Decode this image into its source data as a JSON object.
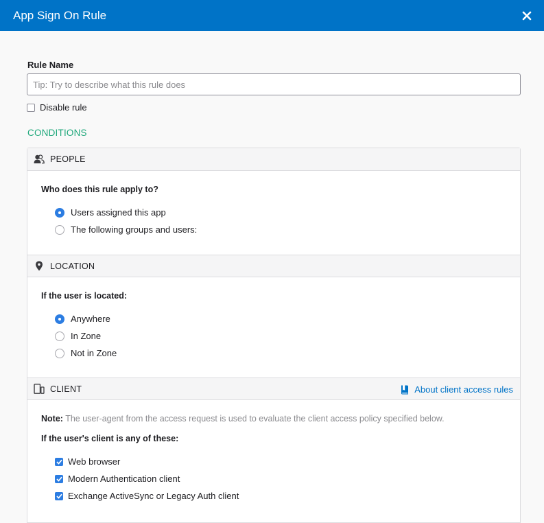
{
  "modal": {
    "title": "App Sign On Rule"
  },
  "rule_name": {
    "label": "Rule Name",
    "value": "",
    "placeholder": "Tip: Try to describe what this rule does"
  },
  "disable_rule": {
    "label": "Disable rule",
    "checked": false
  },
  "conditions_title": "CONDITIONS",
  "people": {
    "title": "PEOPLE",
    "icon": "people-icon",
    "question": "Who does this rule apply to?",
    "options": [
      {
        "label": "Users assigned this app",
        "checked": true
      },
      {
        "label": "The following groups and users:",
        "checked": false
      }
    ]
  },
  "location": {
    "title": "LOCATION",
    "icon": "location-pin-icon",
    "question": "If the user is located:",
    "options": [
      {
        "label": "Anywhere",
        "checked": true
      },
      {
        "label": "In Zone",
        "checked": false
      },
      {
        "label": "Not in Zone",
        "checked": false
      }
    ]
  },
  "client": {
    "title": "CLIENT",
    "icon": "device-icon",
    "about_link": "About client access rules",
    "note_label": "Note:",
    "note_text": "The user-agent from the access request is used to evaluate the client access policy specified below.",
    "question": "If the user's client is any of these:",
    "options": [
      {
        "label": "Web browser",
        "checked": true
      },
      {
        "label": "Modern Authentication client",
        "checked": true
      },
      {
        "label": "Exchange ActiveSync or Legacy Auth client",
        "checked": true
      }
    ]
  },
  "colors": {
    "header_bg": "#0073c7",
    "accent_green": "#1fa87b",
    "link_blue": "#0073c7",
    "control_blue": "#2c7de2"
  }
}
